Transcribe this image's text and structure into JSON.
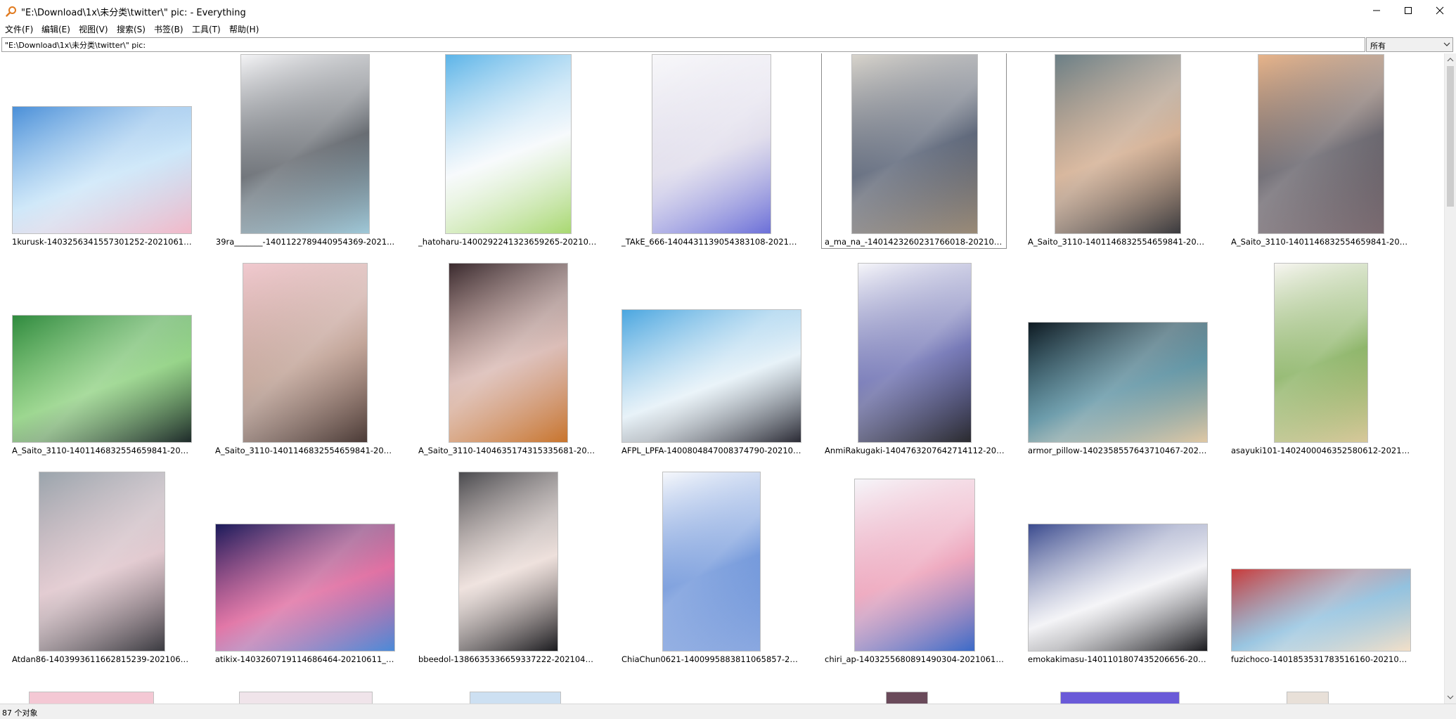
{
  "window": {
    "title": "\"E:\\Download\\1x\\未分类\\twitter\\\" pic: - Everything",
    "minimize_icon": "minimize-icon",
    "maximize_icon": "maximize-icon",
    "close_icon": "close-icon"
  },
  "menu": [
    {
      "label": "文件(F)"
    },
    {
      "label": "编辑(E)"
    },
    {
      "label": "视图(V)"
    },
    {
      "label": "搜索(S)"
    },
    {
      "label": "书签(B)"
    },
    {
      "label": "工具(T)"
    },
    {
      "label": "帮助(H)"
    }
  ],
  "search": {
    "value": "\"E:\\Download\\1x\\未分类\\twitter\\\" pic:",
    "filter_selected": "所有"
  },
  "status": {
    "text": "87 个对象"
  },
  "colors": {
    "app_icon": "#e07a1f",
    "selection_border": "#8c8c8c",
    "scrollbar_thumb": "#cdcdcd"
  },
  "items": [
    {
      "name": "1kurusk-1403256341557301252-20210611...",
      "colors": [
        "#4a8fd8",
        "#bfe0f7",
        "#f2b8c8"
      ],
      "selected": false
    },
    {
      "name": "39ra_______-1401122789440954369-2021...",
      "colors": [
        "#f4f4f6",
        "#3a4048",
        "#9fc8d8"
      ],
      "selected": false
    },
    {
      "name": "_hatoharu-1400292241323659265-202106...",
      "colors": [
        "#5cb4e8",
        "#f4f8fb",
        "#a8d870"
      ],
      "selected": false
    },
    {
      "name": "_TAkE_666-1404431139054383108-202106...",
      "colors": [
        "#f8f8fa",
        "#d8d4e6",
        "#6b6fd8"
      ],
      "selected": false
    },
    {
      "name": "a_ma_na_-1401423260231766018-202106...",
      "colors": [
        "#d8d4cc",
        "#2e3a52",
        "#9a8a76"
      ],
      "selected": true
    },
    {
      "name": "A_Saito_3110-1401146832554659841-2021...",
      "colors": [
        "#6b7f86",
        "#c89a76",
        "#3a3a3e"
      ],
      "selected": false
    },
    {
      "name": "A_Saito_3110-1401146832554659841-2021...",
      "colors": [
        "#e8b48a",
        "#3e3a44",
        "#7a6a70"
      ],
      "selected": false
    },
    {
      "name": "A_Saito_3110-1401146832554659841-2021...",
      "colors": [
        "#2f8a3e",
        "#7bc96a",
        "#1e2a2a"
      ],
      "selected": false
    },
    {
      "name": "A_Saito_3110-1401146832554659841-2021...",
      "colors": [
        "#f1c9cf",
        "#b08a7a",
        "#4a3a36"
      ],
      "selected": false
    },
    {
      "name": "A_Saito_3110-1404635174315335681-2021...",
      "colors": [
        "#3a2a2e",
        "#d0a8a0",
        "#c8742c"
      ],
      "selected": false
    },
    {
      "name": "AFPL_LPFA-1400804847008374790-202106...",
      "colors": [
        "#4aa6e0",
        "#e0eef6",
        "#2a2a34"
      ],
      "selected": false
    },
    {
      "name": "AnmiRakugaki-1404763207642714112-202...",
      "colors": [
        "#f6f6fa",
        "#4a4ea0",
        "#2a2a2e"
      ],
      "selected": false
    },
    {
      "name": "armor_pillow-1402358557643710467-2021...",
      "colors": [
        "#0e1a22",
        "#3a7a8e",
        "#e0c8a4"
      ],
      "selected": false
    },
    {
      "name": "asayuki101-1402400046352580612-202106...",
      "colors": [
        "#f8f6f2",
        "#6a9e3a",
        "#d8c89a"
      ],
      "selected": false
    },
    {
      "name": "Atdan86-1403993611662815239-20210613...",
      "colors": [
        "#9aa4ac",
        "#d8b8c0",
        "#3a3a40"
      ],
      "selected": false
    },
    {
      "name": "atikix-1403260719114686464-20210611_1...",
      "colors": [
        "#1a1a5a",
        "#d84a8a",
        "#4a8ad8"
      ],
      "selected": false
    },
    {
      "name": "bbeedol-1386635336659337222-20210426...",
      "colors": [
        "#4a4a4e",
        "#e8d6d0",
        "#1a1a1e"
      ],
      "selected": false
    },
    {
      "name": "ChiaChun0621-1400995883811065857-202...",
      "colors": [
        "#f6f8fc",
        "#4a7ad0",
        "#8aa8e0"
      ],
      "selected": false
    },
    {
      "name": "chiri_ap-1403255680891490304-20210611...",
      "colors": [
        "#f6f6fa",
        "#e88aa8",
        "#3a6ac8"
      ],
      "selected": false
    },
    {
      "name": "emokakimasu-1401101807435206656-202...",
      "colors": [
        "#3a4a8e",
        "#f0f0f4",
        "#1a1a1e"
      ],
      "selected": false
    },
    {
      "name": "fuzichoco-1401853531783516160-2021060...",
      "colors": [
        "#c83a3a",
        "#7ab4d8",
        "#f4e0c8"
      ],
      "selected": false
    }
  ]
}
